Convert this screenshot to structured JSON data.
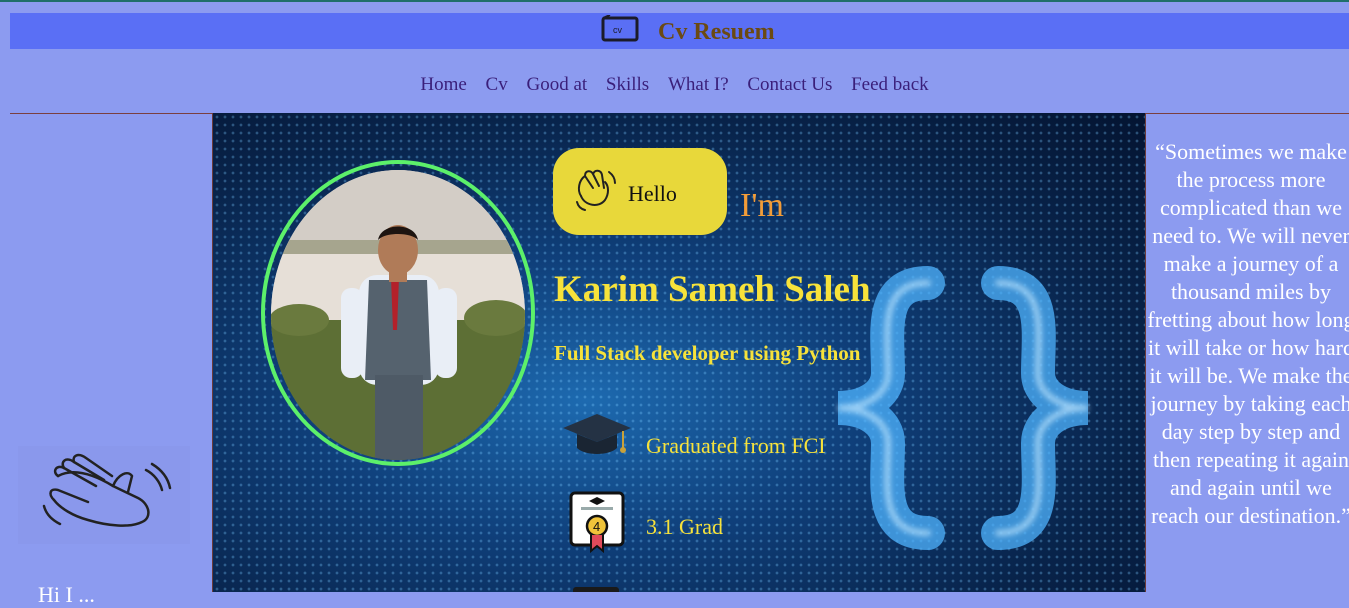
{
  "brand": {
    "title": "Cv Resuem",
    "logo_icon": "cv-monitor-icon"
  },
  "nav": {
    "items": [
      {
        "label": "Home"
      },
      {
        "label": "Cv"
      },
      {
        "label": "Good at"
      },
      {
        "label": "Skills"
      },
      {
        "label": "What I?"
      },
      {
        "label": "Contact Us"
      },
      {
        "label": "Feed back"
      }
    ]
  },
  "left": {
    "icon": "waving-hand-icon",
    "text": "Hi I ..."
  },
  "hero": {
    "greeting": "Hello",
    "im": "I'm",
    "name": "Karim Sameh Saleh",
    "role": "Full Stack developer using Python",
    "items": [
      {
        "icon": "graduation-cap-icon",
        "text": "Graduated from FCI"
      },
      {
        "icon": "certificate-icon",
        "text": "3.1 Grad"
      }
    ],
    "colors": {
      "accent": "#f7e23a",
      "pill": "#e8d83a",
      "ring": "#5cf06a",
      "im": "#f29c38"
    }
  },
  "quote": {
    "text": "“Sometimes we make the process more complicated than we need to. We will never make a journey of a thousand miles by fretting about how long it will take or how hard it will be. We make the journey by taking each day step by step and then repeating it again and again until we reach our destination.”"
  }
}
